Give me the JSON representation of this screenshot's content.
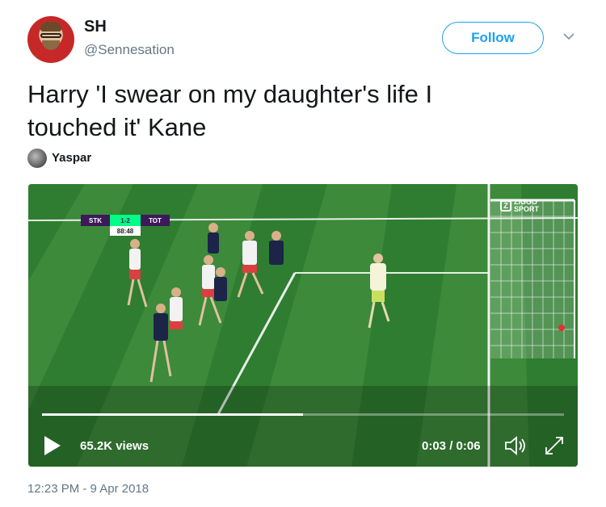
{
  "user": {
    "name": "SH",
    "handle": "@Sennesation"
  },
  "follow_label": "Follow",
  "tweet_text_lines": [
    "Harry 'I swear on my daughter's life I",
    "touched it' Kane"
  ],
  "attribution": "Yaspar",
  "video": {
    "scoreboard": {
      "home": "STK",
      "score": "1-2",
      "away": "TOT",
      "clock": "88:48"
    },
    "broadcaster_logo_text": "ZIGGO SPORT",
    "progress": 0.5,
    "views": "65.2K views",
    "time": "0:03 / 0:06",
    "icons": [
      "play-icon",
      "volume-icon",
      "fullscreen-icon"
    ]
  },
  "timestamp": "12:23 PM - 9 Apr 2018",
  "colors": {
    "accent": "#1da1f2",
    "text": "#14171a",
    "muted": "#657786"
  }
}
